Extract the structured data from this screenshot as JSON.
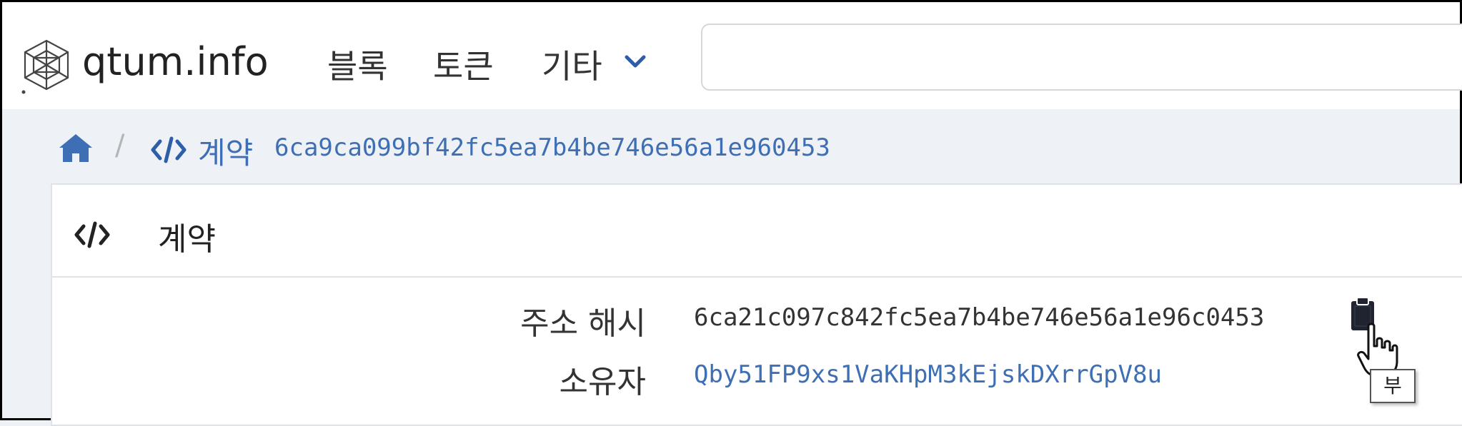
{
  "header": {
    "brand": "qtum.info",
    "nav": {
      "blocks": "블록",
      "tokens": "토큰",
      "more": "기타"
    },
    "search": {
      "placeholder": ""
    }
  },
  "breadcrumb": {
    "label": "계약",
    "hash": "6ca9ca099bf42fc5ea7b4be746e56a1e960453"
  },
  "card": {
    "title": "계약",
    "rows": [
      {
        "label": "주소 해시",
        "value": "6ca21c097c842fc5ea7b4be746e56a1e96c0453"
      },
      {
        "label": "소유자",
        "value": "Qby51FP9xs1VaKHpM3kEjskDXrrGpV8u"
      }
    ]
  },
  "tooltip": {
    "text": "부"
  },
  "colors": {
    "link": "#3e6fb4",
    "page_bg": "#eef1f6",
    "text": "#333333"
  }
}
